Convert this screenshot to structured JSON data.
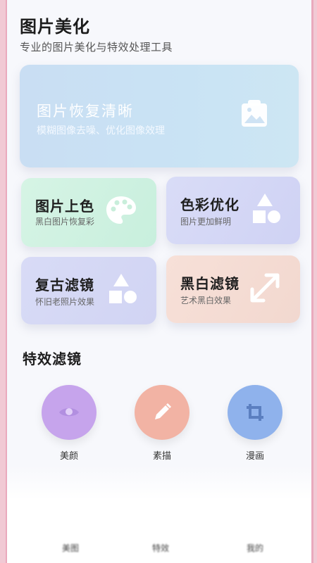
{
  "header": {
    "title": "图片美化",
    "subtitle": "专业的图片美化与特效处理工具"
  },
  "hero": {
    "title": "图片恢复清晰",
    "subtitle": "模糊图像去噪、优化图像效理",
    "icon": "image-icon",
    "color": "#c9e0f3"
  },
  "cards": [
    {
      "title": "图片上色",
      "subtitle": "黑白图片恢复彩色",
      "icon": "palette-icon",
      "color": "#d3f2e3"
    },
    {
      "title": "色彩优化",
      "subtitle": "图片更加鲜明",
      "icon": "shapes-icon",
      "color": "#d5d8f6"
    },
    {
      "title": "复古滤镜",
      "subtitle": "怀旧老照片效果",
      "icon": "shapes-icon",
      "color": "#d5d8f5"
    },
    {
      "title": "黑白滤镜",
      "subtitle": "艺术黑白效果",
      "icon": "expand-arrows-icon",
      "color": "#f5ddd4"
    }
  ],
  "effects": {
    "title": "特效滤镜",
    "items": [
      {
        "label": "美颜",
        "icon": "eye-icon",
        "color": "#c6a4ec"
      },
      {
        "label": "素描",
        "icon": "pencil-icon",
        "color": "#f2b3a4"
      },
      {
        "label": "漫画",
        "icon": "crop-icon",
        "color": "#8fb2ec"
      }
    ]
  },
  "tabbar": {
    "items": [
      {
        "label": "美图"
      },
      {
        "label": "特效"
      },
      {
        "label": "我的"
      }
    ]
  }
}
